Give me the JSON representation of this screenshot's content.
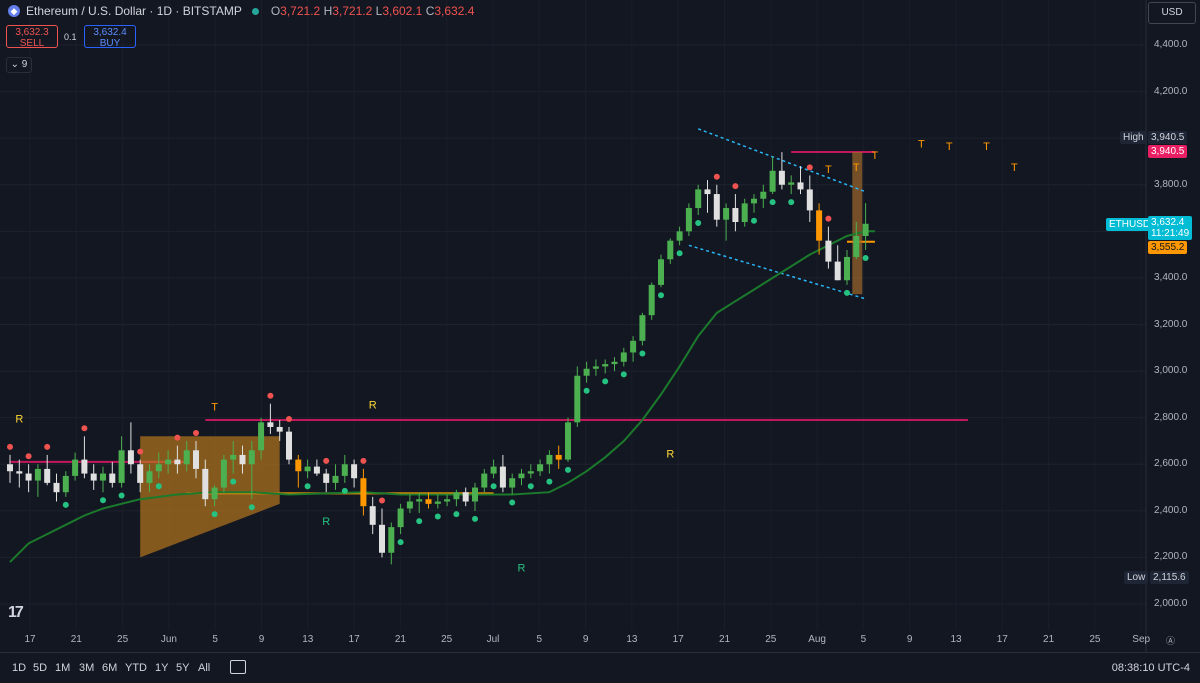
{
  "header": {
    "symbol": "Ethereum / U.S. Dollar · 1D · BITSTAMP",
    "o_label": "O",
    "o_value": "3,721.2",
    "h_label": "H",
    "h_value": "3,721.2",
    "l_label": "L",
    "l_value": "3,602.1",
    "c_label": "C",
    "c_value": "3,632.4"
  },
  "trade": {
    "sell_price": "3,632.3",
    "sell_label": "SELL",
    "spread": "0.1",
    "buy_price": "3,632.4",
    "buy_label": "BUY"
  },
  "indicators_count": "9",
  "currency": "USD",
  "price_tags": {
    "high_label": "High",
    "high_value": "3,940.5",
    "high_line_value": "3,940.5",
    "symbol": "ETHUSD",
    "last": "3,632.4",
    "countdown": "11:21:49",
    "orange_value": "3,555.2",
    "low_label": "Low",
    "low_value": "2,115.6"
  },
  "bottom": {
    "ranges": [
      "1D",
      "5D",
      "1M",
      "3M",
      "6M",
      "YTD",
      "1Y",
      "5Y",
      "All"
    ],
    "time": "08:38:10 UTC-4"
  },
  "logo": "17",
  "colors": {
    "up": "#4caf50",
    "down": "#ffffff",
    "orange": "#ff9800",
    "signal_green": "#26c281",
    "signal_red": "#ef5350",
    "ma": "#1b7a2b",
    "magenta": "#e91e63"
  },
  "chart_data": {
    "type": "candlestick",
    "symbol": "ETHUSD",
    "interval": "1D",
    "ylim": [
      1950,
      4550
    ],
    "y_ticks": [
      2000,
      2200,
      2400,
      2600,
      2800,
      3000,
      3200,
      3400,
      3600,
      3800,
      4000,
      4200,
      4400
    ],
    "y_tick_labels": [
      "2,000.0",
      "2,200.0",
      "2,400.0",
      "2,600.0",
      "2,800.0",
      "3,000.0",
      "3,200.0",
      "3,400.0",
      "3,600.0",
      "3,800.0",
      "4,000.0",
      "4,200.0",
      "4,400.0"
    ],
    "x_ticks": [
      "17",
      "21",
      "25",
      "Jun",
      "5",
      "9",
      "13",
      "17",
      "21",
      "25",
      "Jul",
      "5",
      "9",
      "13",
      "17",
      "21",
      "25",
      "Aug",
      "5",
      "9",
      "13",
      "17",
      "21",
      "25",
      "Sep"
    ],
    "candles": [
      [
        2600,
        2640,
        2520,
        2570
      ],
      [
        2570,
        2620,
        2500,
        2560
      ],
      [
        2560,
        2600,
        2480,
        2530
      ],
      [
        2530,
        2600,
        2460,
        2580
      ],
      [
        2580,
        2640,
        2510,
        2520
      ],
      [
        2520,
        2560,
        2440,
        2480
      ],
      [
        2480,
        2570,
        2460,
        2550
      ],
      [
        2550,
        2650,
        2530,
        2620
      ],
      [
        2620,
        2720,
        2540,
        2560
      ],
      [
        2560,
        2600,
        2490,
        2530
      ],
      [
        2530,
        2590,
        2480,
        2560
      ],
      [
        2560,
        2610,
        2500,
        2520
      ],
      [
        2520,
        2720,
        2500,
        2660
      ],
      [
        2660,
        2780,
        2560,
        2600
      ],
      [
        2600,
        2620,
        2480,
        2520
      ],
      [
        2520,
        2600,
        2480,
        2570
      ],
      [
        2570,
        2650,
        2540,
        2600
      ],
      [
        2600,
        2660,
        2560,
        2620
      ],
      [
        2620,
        2680,
        2560,
        2600
      ],
      [
        2600,
        2700,
        2570,
        2660
      ],
      [
        2660,
        2700,
        2540,
        2580
      ],
      [
        2580,
        2620,
        2420,
        2450
      ],
      [
        2450,
        2510,
        2420,
        2500
      ],
      [
        2500,
        2640,
        2480,
        2620
      ],
      [
        2620,
        2700,
        2560,
        2640
      ],
      [
        2640,
        2680,
        2560,
        2600
      ],
      [
        2600,
        2700,
        2450,
        2660
      ],
      [
        2660,
        2800,
        2620,
        2780
      ],
      [
        2780,
        2860,
        2730,
        2760
      ],
      [
        2760,
        2790,
        2700,
        2740
      ],
      [
        2740,
        2760,
        2600,
        2620
      ],
      [
        2620,
        2640,
        2500,
        2570
      ],
      [
        2570,
        2620,
        2540,
        2590
      ],
      [
        2590,
        2620,
        2550,
        2560
      ],
      [
        2560,
        2580,
        2480,
        2520
      ],
      [
        2520,
        2600,
        2490,
        2550
      ],
      [
        2550,
        2640,
        2520,
        2600
      ],
      [
        2600,
        2620,
        2500,
        2540
      ],
      [
        2540,
        2580,
        2380,
        2420
      ],
      [
        2420,
        2460,
        2300,
        2340
      ],
      [
        2340,
        2410,
        2200,
        2220
      ],
      [
        2220,
        2350,
        2170,
        2330
      ],
      [
        2330,
        2430,
        2300,
        2410
      ],
      [
        2410,
        2470,
        2390,
        2440
      ],
      [
        2440,
        2480,
        2390,
        2450
      ],
      [
        2450,
        2480,
        2410,
        2430
      ],
      [
        2430,
        2470,
        2410,
        2440
      ],
      [
        2440,
        2470,
        2420,
        2450
      ],
      [
        2450,
        2490,
        2420,
        2480
      ],
      [
        2480,
        2500,
        2420,
        2440
      ],
      [
        2440,
        2520,
        2400,
        2500
      ],
      [
        2500,
        2580,
        2480,
        2560
      ],
      [
        2560,
        2620,
        2540,
        2590
      ],
      [
        2590,
        2640,
        2480,
        2500
      ],
      [
        2500,
        2560,
        2470,
        2540
      ],
      [
        2540,
        2580,
        2510,
        2560
      ],
      [
        2560,
        2600,
        2540,
        2570
      ],
      [
        2570,
        2620,
        2550,
        2600
      ],
      [
        2600,
        2660,
        2560,
        2640
      ],
      [
        2640,
        2680,
        2580,
        2620
      ],
      [
        2620,
        2800,
        2610,
        2780
      ],
      [
        2780,
        3020,
        2760,
        2980
      ],
      [
        2980,
        3040,
        2950,
        3010
      ],
      [
        3010,
        3050,
        2980,
        3020
      ],
      [
        3020,
        3050,
        2990,
        3030
      ],
      [
        3030,
        3060,
        3000,
        3040
      ],
      [
        3040,
        3100,
        3020,
        3080
      ],
      [
        3080,
        3150,
        3040,
        3130
      ],
      [
        3130,
        3250,
        3110,
        3240
      ],
      [
        3240,
        3380,
        3220,
        3370
      ],
      [
        3370,
        3500,
        3360,
        3480
      ],
      [
        3480,
        3570,
        3460,
        3560
      ],
      [
        3560,
        3620,
        3540,
        3600
      ],
      [
        3600,
        3720,
        3580,
        3700
      ],
      [
        3700,
        3800,
        3670,
        3780
      ],
      [
        3780,
        3820,
        3680,
        3760
      ],
      [
        3760,
        3800,
        3620,
        3650
      ],
      [
        3650,
        3720,
        3560,
        3700
      ],
      [
        3700,
        3760,
        3600,
        3640
      ],
      [
        3640,
        3740,
        3620,
        3720
      ],
      [
        3720,
        3760,
        3680,
        3740
      ],
      [
        3740,
        3800,
        3700,
        3770
      ],
      [
        3770,
        3920,
        3760,
        3860
      ],
      [
        3860,
        3940,
        3780,
        3800
      ],
      [
        3800,
        3840,
        3760,
        3810
      ],
      [
        3810,
        3880,
        3760,
        3780
      ],
      [
        3780,
        3840,
        3640,
        3690
      ],
      [
        3690,
        3720,
        3500,
        3560
      ],
      [
        3560,
        3620,
        3440,
        3470
      ],
      [
        3470,
        3540,
        3390,
        3390
      ],
      [
        3390,
        3520,
        3370,
        3490
      ],
      [
        3490,
        3640,
        3480,
        3580
      ],
      [
        3580,
        3721.2,
        3520,
        3632.4
      ]
    ],
    "moving_average": [
      [
        0,
        2180
      ],
      [
        2,
        2260
      ],
      [
        4,
        2300
      ],
      [
        6,
        2340
      ],
      [
        8,
        2380
      ],
      [
        10,
        2410
      ],
      [
        12,
        2430
      ],
      [
        14,
        2450
      ],
      [
        16,
        2460
      ],
      [
        18,
        2470
      ],
      [
        22,
        2480
      ],
      [
        26,
        2480
      ],
      [
        30,
        2470
      ],
      [
        34,
        2475
      ],
      [
        38,
        2480
      ],
      [
        42,
        2470
      ],
      [
        46,
        2470
      ],
      [
        50,
        2470
      ],
      [
        54,
        2470
      ],
      [
        58,
        2480
      ],
      [
        60,
        2520
      ],
      [
        62,
        2570
      ],
      [
        64,
        2630
      ],
      [
        66,
        2700
      ],
      [
        68,
        2790
      ],
      [
        70,
        2900
      ],
      [
        72,
        3020
      ],
      [
        74,
        3150
      ],
      [
        76,
        3250
      ],
      [
        78,
        3300
      ],
      [
        80,
        3350
      ],
      [
        82,
        3400
      ],
      [
        84,
        3450
      ],
      [
        86,
        3500
      ],
      [
        88,
        3540
      ],
      [
        90,
        3580
      ],
      [
        92,
        3600
      ],
      [
        93,
        3600
      ]
    ],
    "horizontal_levels": [
      {
        "y": 2610,
        "x0": 0,
        "x1": 19,
        "color": "magenta"
      },
      {
        "y": 2790,
        "x0": 21,
        "x1": 103,
        "color": "magenta"
      },
      {
        "y": 2475,
        "x0": 19,
        "x1": 52,
        "color": "orange"
      },
      {
        "y": 3555.2,
        "x0": 90,
        "x1": 93,
        "color": "orange"
      },
      {
        "y": 3940.5,
        "x0": 84,
        "x1": 93,
        "color": "magenta"
      }
    ],
    "markers_T": [
      [
        22,
        2830
      ],
      [
        88,
        3850
      ],
      [
        91,
        3860
      ],
      [
        93,
        3910
      ],
      [
        98,
        3960
      ],
      [
        101,
        3950
      ],
      [
        105,
        3950
      ],
      [
        108,
        3860
      ]
    ],
    "markers_R": [
      [
        1,
        2780
      ],
      [
        39,
        2840
      ],
      [
        71,
        2630
      ],
      [
        34,
        2340
      ],
      [
        55,
        2140
      ]
    ]
  }
}
